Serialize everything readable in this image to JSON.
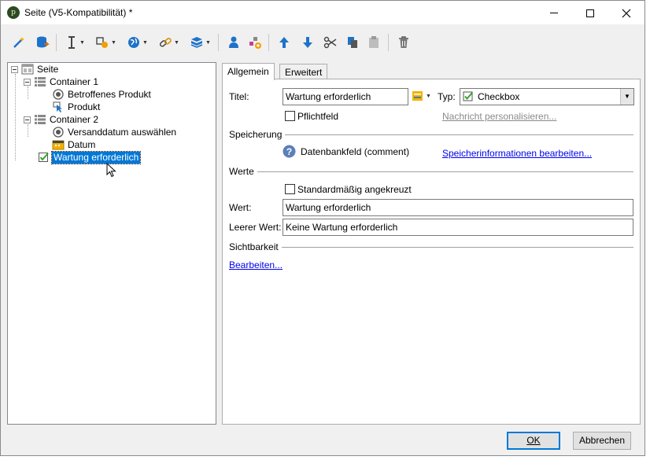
{
  "window": {
    "title": "Seite (V5-Kompatibilität) *",
    "app_icon_glyph": "p"
  },
  "toolbar": {
    "icons": [
      "magic-wand-icon",
      "database-icon",
      "text-cursor-icon",
      "shapes-icon",
      "globe-icon",
      "link-icon",
      "box-icon",
      "user-icon",
      "add-component-icon",
      "arrow-up-icon",
      "arrow-down-icon",
      "cut-icon",
      "copy-icon",
      "paste-icon",
      "delete-icon"
    ]
  },
  "tree": {
    "root": "Seite",
    "container1": "Container 1",
    "item_product_affected": "Betroffenes Produkt",
    "item_product": "Produkt",
    "container2": "Container 2",
    "item_ship_date": "Versanddatum auswählen",
    "item_date": "Datum",
    "item_maintenance": "Wartung erforderlich"
  },
  "tabs": {
    "general": "Allgemein",
    "advanced": "Erweitert"
  },
  "form": {
    "title_label": "Titel:",
    "title_value": "Wartung erforderlich",
    "type_label": "Typ:",
    "type_value": "Checkbox",
    "required_label": "Pflichtfeld",
    "personalize_link": "Nachricht personalisieren...",
    "storage_section": "Speicherung",
    "db_field": "Datenbankfeld (comment)",
    "storage_link": "Speicherinformationen bearbeiten...",
    "values_section": "Werte",
    "default_checked_label": "Standardmäßig angekreuzt",
    "value_label": "Wert:",
    "value_value": "Wartung erforderlich",
    "empty_value_label": "Leerer Wert:",
    "empty_value_value": "Keine Wartung erforderlich",
    "visibility_section": "Sichtbarkeit",
    "edit_link": "Bearbeiten..."
  },
  "buttons": {
    "ok": "OK",
    "cancel": "Abbrechen"
  },
  "colors": {
    "selection": "#0078d7",
    "link": "#0000ee",
    "toolbar_blue": "#1f72c9"
  }
}
